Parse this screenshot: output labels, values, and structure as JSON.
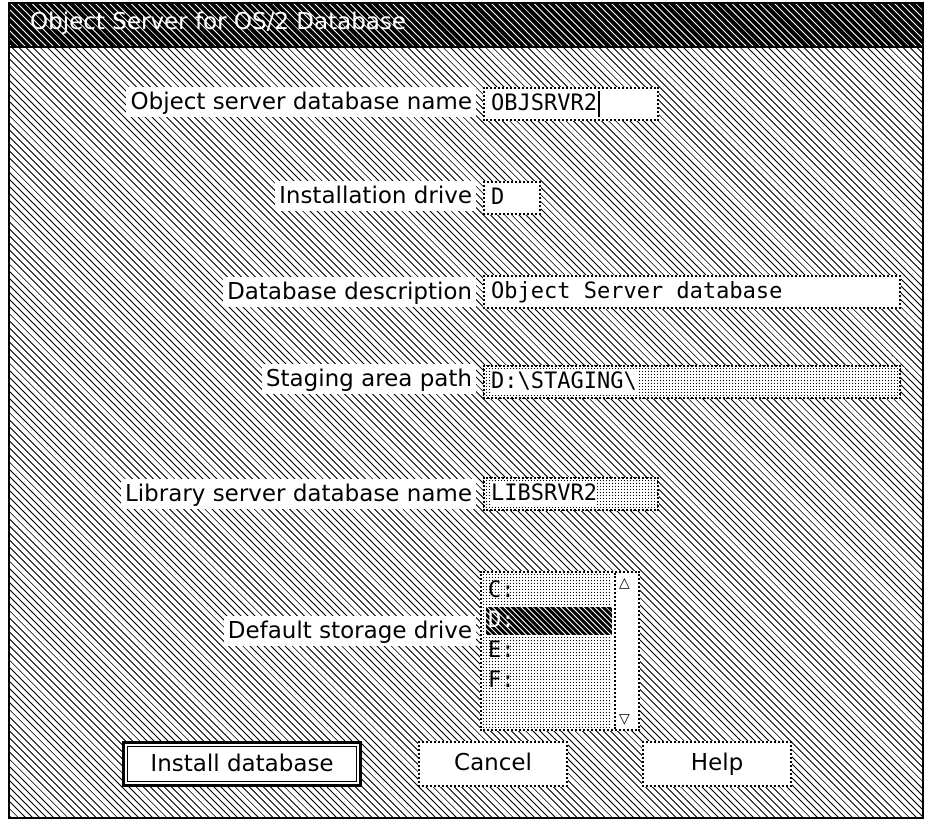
{
  "window": {
    "title": "Object Server for OS/2 Database"
  },
  "form": {
    "object_server_db_name": {
      "label": "Object server database name",
      "value": "OBJSRVR2"
    },
    "installation_drive": {
      "label": "Installation drive",
      "value": "D"
    },
    "database_description": {
      "label": "Database description",
      "value": "Object Server database"
    },
    "staging_area_path": {
      "label": "Staging area path",
      "value": "D:\\STAGING\\"
    },
    "library_server_db_name": {
      "label": "Library server database name",
      "value": "LIBSRVR2"
    },
    "default_storage_drive": {
      "label": "Default storage drive",
      "options": [
        "C:",
        "D:",
        "E:",
        "F:"
      ],
      "selected": "D:"
    }
  },
  "buttons": {
    "install": "Install database",
    "cancel": "Cancel",
    "help": "Help"
  }
}
